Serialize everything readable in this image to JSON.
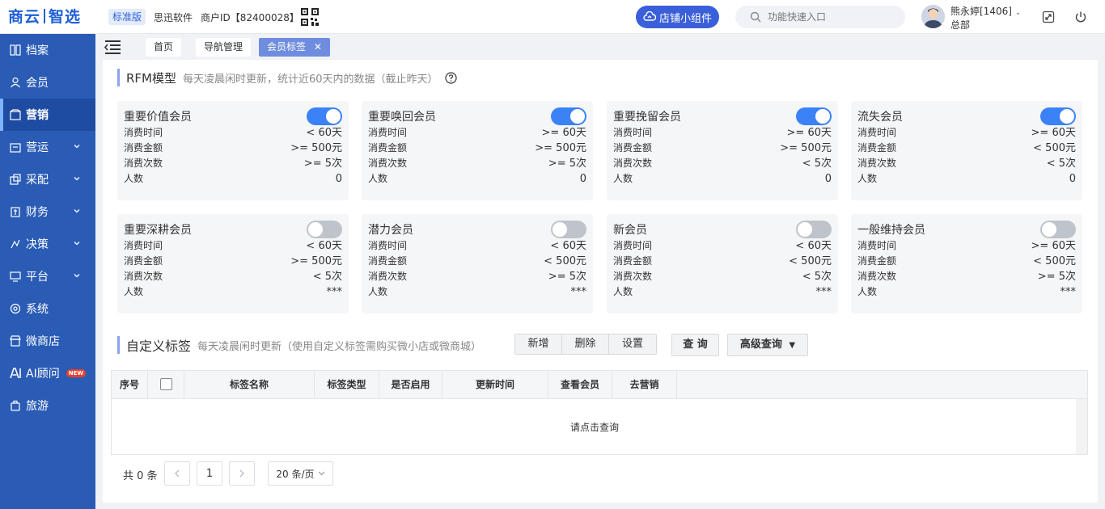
{
  "header": {
    "logo_left": "商云",
    "logo_right": "智选",
    "edition": "标准版",
    "company": "思迅软件",
    "merchant": "商户ID【82400028】",
    "widget_button": "店铺小组件",
    "search_placeholder": "功能快速入口",
    "user_name": "熊永婷[1406]",
    "user_dept": "总部"
  },
  "sidebar": {
    "items": [
      {
        "label": "档案",
        "icon": "archive-icon",
        "expandable": false
      },
      {
        "label": "会员",
        "icon": "user-icon",
        "expandable": false
      },
      {
        "label": "营销",
        "icon": "marketing-icon",
        "expandable": false,
        "active": true
      },
      {
        "label": "营运",
        "icon": "operation-icon",
        "expandable": true
      },
      {
        "label": "采配",
        "icon": "purchase-icon",
        "expandable": true
      },
      {
        "label": "财务",
        "icon": "finance-icon",
        "expandable": true
      },
      {
        "label": "决策",
        "icon": "decision-icon",
        "expandable": true
      },
      {
        "label": "平台",
        "icon": "platform-icon",
        "expandable": true
      },
      {
        "label": "系统",
        "icon": "system-icon",
        "expandable": false
      },
      {
        "label": "微商店",
        "icon": "shop-icon",
        "expandable": false
      },
      {
        "label": "AI顾问",
        "icon": "ai-icon",
        "expandable": false,
        "badge": "NEW"
      },
      {
        "label": "旅游",
        "icon": "travel-icon",
        "expandable": false
      }
    ]
  },
  "tabs": [
    {
      "label": "首页",
      "active": false
    },
    {
      "label": "导航管理",
      "active": false
    },
    {
      "label": "会员标签",
      "active": true,
      "close": "✕"
    }
  ],
  "rfm": {
    "title": "RFM模型",
    "desc": "每天凌晨闲时更新，统计近60天内的数据（截止昨天）",
    "row_labels": [
      "消费时间",
      "消费金额",
      "消费次数",
      "人数"
    ],
    "cards": [
      {
        "name": "重要价值会员",
        "enabled": true,
        "values": [
          "< 60天",
          ">= 500元",
          ">= 5次",
          "0"
        ]
      },
      {
        "name": "重要唤回会员",
        "enabled": true,
        "values": [
          ">= 60天",
          ">= 500元",
          ">= 5次",
          "0"
        ]
      },
      {
        "name": "重要挽留会员",
        "enabled": true,
        "values": [
          ">= 60天",
          ">= 500元",
          "< 5次",
          "0"
        ]
      },
      {
        "name": "流失会员",
        "enabled": true,
        "values": [
          ">= 60天",
          "< 500元",
          "< 5次",
          "0"
        ]
      },
      {
        "name": "重要深耕会员",
        "enabled": false,
        "values": [
          "< 60天",
          ">= 500元",
          "< 5次",
          "***"
        ]
      },
      {
        "name": "潜力会员",
        "enabled": false,
        "values": [
          "< 60天",
          "< 500元",
          ">= 5次",
          "***"
        ]
      },
      {
        "name": "新会员",
        "enabled": false,
        "values": [
          "< 60天",
          "< 500元",
          "< 5次",
          "***"
        ]
      },
      {
        "name": "一般维持会员",
        "enabled": false,
        "values": [
          ">= 60天",
          "< 500元",
          ">= 5次",
          "***"
        ]
      }
    ]
  },
  "custom": {
    "title": "自定义标签",
    "desc": "每天凌晨闲时更新（使用自定义标签需购买微小店或微商城）",
    "buttons": {
      "add": "新增",
      "delete": "删除",
      "settings": "设置",
      "query": "查 询",
      "advanced": "高级查询"
    }
  },
  "table": {
    "columns": [
      "序号",
      "",
      "标签名称",
      "标签类型",
      "是否启用",
      "更新时间",
      "查看会员",
      "去营销"
    ],
    "empty_text": "请点击查询"
  },
  "pagination": {
    "total_text": "共 0 条",
    "current_page": "1",
    "page_size": "20 条/页"
  },
  "colors": {
    "sidebar": "#2a5cb6",
    "accent": "#3a5fd9",
    "toggle_on": "#3b82f6",
    "toggle_off": "#bfc3ca"
  }
}
